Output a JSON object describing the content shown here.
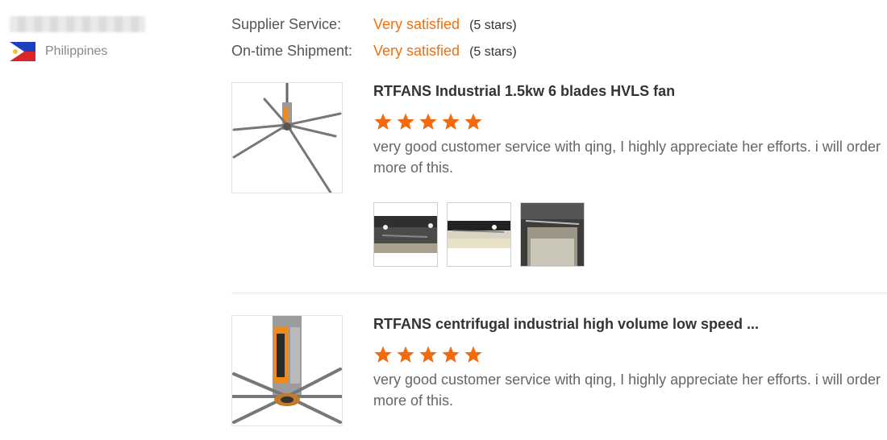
{
  "reviewer": {
    "name_redacted": true,
    "country": "Philippines"
  },
  "ratings": [
    {
      "label": "Supplier Service:",
      "value": "Very satisfied",
      "stars_text": "(5 stars)"
    },
    {
      "label": "On-time Shipment:",
      "value": "Very satisfied",
      "stars_text": "(5 stars)"
    }
  ],
  "reviews": [
    {
      "product_title": "RTFANS Industrial 1.5kw 6 blades HVLS fan",
      "rating": 5,
      "text": "very good customer service with qing, I highly appreciate her efforts. i will order more of this.",
      "photo_count": 3
    },
    {
      "product_title": "RTFANS centrifugal industrial high volume low speed ...",
      "rating": 5,
      "text": "very good customer service with qing, I highly appreciate her efforts. i will order more of this.",
      "photo_count": 0
    }
  ],
  "colors": {
    "accent": "#f36f0a",
    "star": "#f26b0f",
    "divider": "#e5e5e5"
  }
}
